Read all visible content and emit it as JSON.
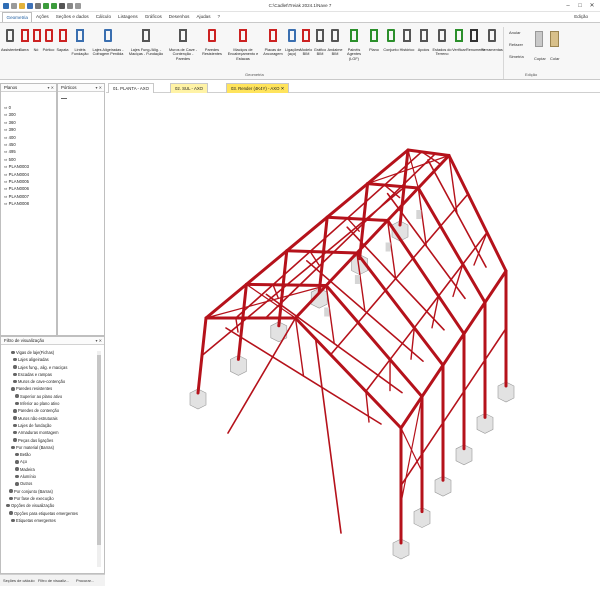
{
  "window": {
    "title": "C:\\Cadlet\\Treiak 2024.1\\Nave 7",
    "minimize": "–",
    "maximize": "□",
    "close": "✕"
  },
  "menu": {
    "tabs": [
      "Geometria",
      "Ações",
      "Seções e dados",
      "Cálculo",
      "Listagens",
      "Gráficos",
      "Desenhos",
      "Ajudas",
      "?"
    ],
    "active": "Geometria",
    "editar": "Edição"
  },
  "ribbon": {
    "buttons": [
      {
        "label": "Assistentes",
        "icon": "wizard-icon"
      },
      {
        "label": "Barra",
        "icon": "bar-icon"
      },
      {
        "label": "Nó",
        "icon": "node-icon"
      },
      {
        "label": "Pórtico",
        "icon": "portal-icon"
      },
      {
        "label": "Sapata",
        "icon": "footing-icon"
      },
      {
        "label": "Lintéis Fundação",
        "icon": "lintel-icon"
      },
      {
        "label": "Lajes Aligeiradas - Cofragem Perdida",
        "icon": "slab-icon"
      },
      {
        "label": "Lajes Fung./Alig. - Maciças - Fundação",
        "icon": "flat-slab-icon"
      },
      {
        "label": "Muros de Cave - Contenção - Paredes",
        "icon": "basement-wall-icon"
      },
      {
        "label": "Paredes Resistentes",
        "icon": "wall-icon"
      },
      {
        "label": "Maciços de Encabeçamento e Estacas",
        "icon": "pile-cap-icon"
      },
      {
        "label": "Placas de Ancoragem",
        "icon": "anchor-plate-icon"
      },
      {
        "label": "Ligações (aço)",
        "icon": "steel-connection-icon"
      },
      {
        "label": "Modelo BIM",
        "icon": "bim-model-icon"
      },
      {
        "label": "Gráfico BIM",
        "icon": "bim-chart-icon"
      },
      {
        "label": "Andaime BIM",
        "icon": "scaffold-icon"
      },
      {
        "label": "Painéis Agentes (LGF)",
        "icon": "panel-icon"
      },
      {
        "label": "Plano",
        "icon": "plane-icon"
      },
      {
        "label": "Conjunto",
        "icon": "set-icon"
      },
      {
        "label": "Histórico",
        "icon": "history-icon"
      },
      {
        "label": "Apoios",
        "icon": "support-icon"
      },
      {
        "label": "Estados do Terreno",
        "icon": "terrain-icon"
      },
      {
        "label": "Verificar",
        "icon": "verify-icon"
      },
      {
        "label": "Renumerar",
        "icon": "renumber-icon"
      },
      {
        "label": "Ferramentas",
        "icon": "tools-icon"
      }
    ],
    "group_geometria": "Geometria",
    "group_edicao": "Edição",
    "anular": "Anular",
    "refazer": "Refazer",
    "simetria": "Simetria",
    "copiar": "Copiar",
    "colar": "Colar"
  },
  "doc_tabs": [
    {
      "label": "01. PLANTA - AXO"
    },
    {
      "label": "02. SUL - AXO"
    },
    {
      "label": "03. Render (4K4Y) - AXO"
    }
  ],
  "planes_panel": {
    "title": "Planos",
    "items": [
      "0",
      "300",
      "360",
      "390",
      "400",
      "450",
      "495",
      "500",
      "PLAN0003",
      "PLAN0004",
      "PLAN0005",
      "PLAN0006",
      "PLAN0007",
      "PLAN0008"
    ]
  },
  "porticos_panel": {
    "title": "Pórticos"
  },
  "filter_panel": {
    "title": "Filtro de visualização",
    "items": [
      "Vigas de laje(Fichas)",
      "Lajes aligeiradas",
      "Lajes fung., alig. e maciças",
      "Escadas e rampas",
      "Muros de cave-contenção",
      "Paredes resistentes",
      "Superior ao plano ativo",
      "Inferior ao plano ativo",
      "Paredes de contenção",
      "Muros não estruturais",
      "Lajes de fundação",
      "Armaduras montagem",
      "Peças das ligações",
      "Por material (Barras)",
      "Betão",
      "Aço",
      "Madeira",
      "Alumínio",
      "Outros",
      "Por conjunto (Barras)",
      "Por fase de execução",
      "Opções de visualização",
      "Opções para etiquetas emergentes",
      "Etiquetas emergentes"
    ]
  },
  "bottom_tabs": [
    "Seções de cálculo",
    "Filtro de visualiz...",
    "Procurar..."
  ]
}
